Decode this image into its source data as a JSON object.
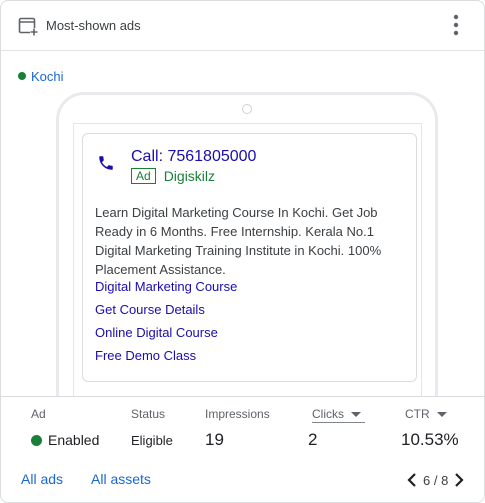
{
  "header": {
    "title": "Most-shown ads",
    "title_icon": "add-to-box-icon",
    "menu_icon": "more-vert-icon"
  },
  "location": {
    "name": "Kochi",
    "status_color": "#188038"
  },
  "ad_preview": {
    "call_label": "Call: 7561805000",
    "ad_badge": "Ad",
    "advertiser": "Digiskilz",
    "description": "Learn Digital Marketing Course In Kochi. Get Job Ready in 6 Months. Free Internship. Kerala No.1 Digital Marketing Training Institute in Kochi. 100% Placement Assistance.",
    "sitelinks": [
      "Digital Marketing Course",
      "Get Course Details",
      "Online Digital Course",
      "Free Demo Class"
    ]
  },
  "stats": {
    "headers": {
      "ad": "Ad",
      "status": "Status",
      "impressions": "Impressions",
      "clicks": "Clicks",
      "ctr": "CTR"
    },
    "values": {
      "ad": "Enabled",
      "status": "Eligible",
      "impressions": "19",
      "clicks": "2",
      "ctr": "10.53%"
    }
  },
  "footer": {
    "all_ads": "All ads",
    "all_assets": "All assets",
    "page": "6 / 8"
  },
  "colors": {
    "accent": "#1967d2",
    "link": "#1a0dab",
    "green": "#188038"
  }
}
